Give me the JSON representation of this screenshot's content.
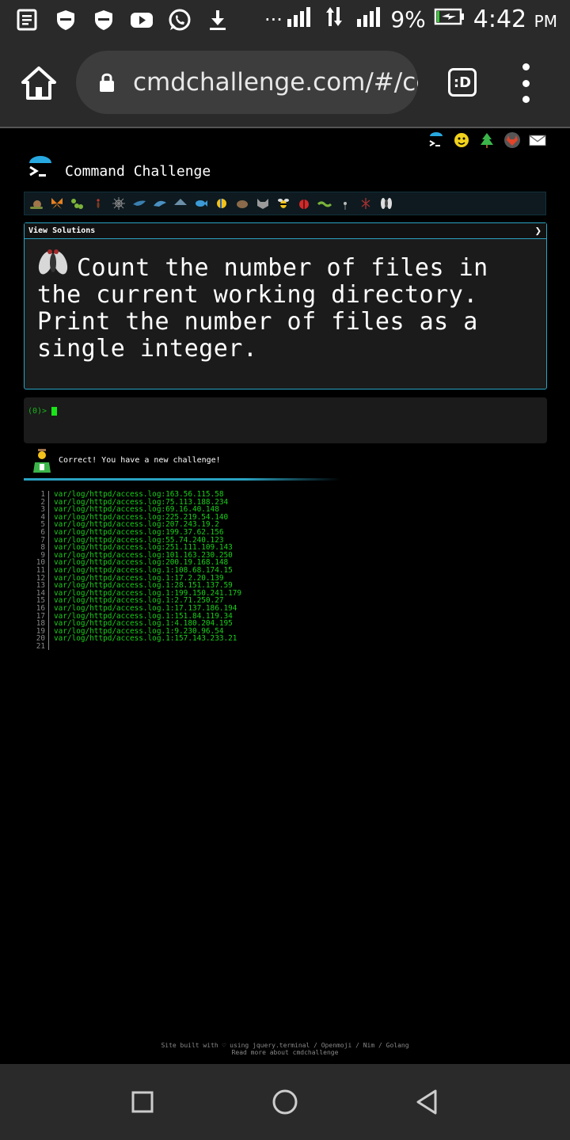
{
  "status_bar": {
    "icons": [
      "notes-icon",
      "shield-icon",
      "shield-icon",
      "youtube-icon",
      "whatsapp-icon",
      "download-icon"
    ],
    "overflow": "···",
    "battery": "9%",
    "time": "4:42",
    "ampm": "PM"
  },
  "browser": {
    "url": "cmdchallenge.com/#/cc",
    "tabs_label": ":D"
  },
  "site": {
    "title": "Command Challenge",
    "header_icons": [
      "cmdchallenge-icon",
      "emoji-icon",
      "tree-icon",
      "gitlab-icon",
      "mail-icon"
    ]
  },
  "level_icons": [
    "snail-icon",
    "butterfly-icon",
    "caterpillar-icon",
    "ant-icon",
    "spider-icon",
    "bird-icon",
    "dolphin-icon",
    "shark-icon",
    "fish-icon",
    "tropical-fish-icon",
    "hedgehog-icon",
    "raccoon-icon",
    "bee-icon",
    "ladybug-icon",
    "worm-icon",
    "mosquito-icon",
    "cricket-icon",
    "fly-icon"
  ],
  "challenge": {
    "view_solutions": "View Solutions",
    "chevron": "❯",
    "text": "Count the number of files in the current working directory. Print the number of files as a single integer."
  },
  "terminal": {
    "prompt": "(0)>"
  },
  "result": {
    "message": "Correct! You have a new challenge!"
  },
  "output_lines": [
    {
      "n": "1",
      "t": "var/log/httpd/access.log:163.56.115.58"
    },
    {
      "n": "2",
      "t": "var/log/httpd/access.log:75.113.188.234"
    },
    {
      "n": "3",
      "t": "var/log/httpd/access.log:69.16.40.148"
    },
    {
      "n": "4",
      "t": "var/log/httpd/access.log:225.219.54.140"
    },
    {
      "n": "5",
      "t": "var/log/httpd/access.log:207.243.19.2"
    },
    {
      "n": "6",
      "t": "var/log/httpd/access.log:199.37.62.156"
    },
    {
      "n": "7",
      "t": "var/log/httpd/access.log:55.74.240.123"
    },
    {
      "n": "8",
      "t": "var/log/httpd/access.log:251.111.109.143"
    },
    {
      "n": "9",
      "t": "var/log/httpd/access.log:101.163.230.250"
    },
    {
      "n": "10",
      "t": "var/log/httpd/access.log:200.19.168.148"
    },
    {
      "n": "11",
      "t": "var/log/httpd/access.log.1:108.68.174.15"
    },
    {
      "n": "12",
      "t": "var/log/httpd/access.log.1:17.2.20.139"
    },
    {
      "n": "13",
      "t": "var/log/httpd/access.log.1:28.151.137.59"
    },
    {
      "n": "14",
      "t": "var/log/httpd/access.log.1:199.150.241.179"
    },
    {
      "n": "15",
      "t": "var/log/httpd/access.log.1:2.71.250.27"
    },
    {
      "n": "16",
      "t": "var/log/httpd/access.log.1:17.137.186.194"
    },
    {
      "n": "17",
      "t": "var/log/httpd/access.log.1:151.84.119.34"
    },
    {
      "n": "18",
      "t": "var/log/httpd/access.log.1:4.180.204.195"
    },
    {
      "n": "19",
      "t": "var/log/httpd/access.log.1:9.230.96.54"
    },
    {
      "n": "20",
      "t": "var/log/httpd/access.log.1:157.143.233.21"
    },
    {
      "n": "21",
      "t": ""
    }
  ],
  "footer": {
    "line1": "Site built with ♡ using jquery.terminal / Openmoji / Nim / Golang",
    "line2": "Read more about cmdchallenge"
  },
  "navbar": {
    "buttons": [
      "recents-button",
      "home-button",
      "back-button"
    ]
  },
  "colors": {
    "accent": "#2aa3c2",
    "terminal_green": "#19d019",
    "page_bg": "#000000"
  }
}
